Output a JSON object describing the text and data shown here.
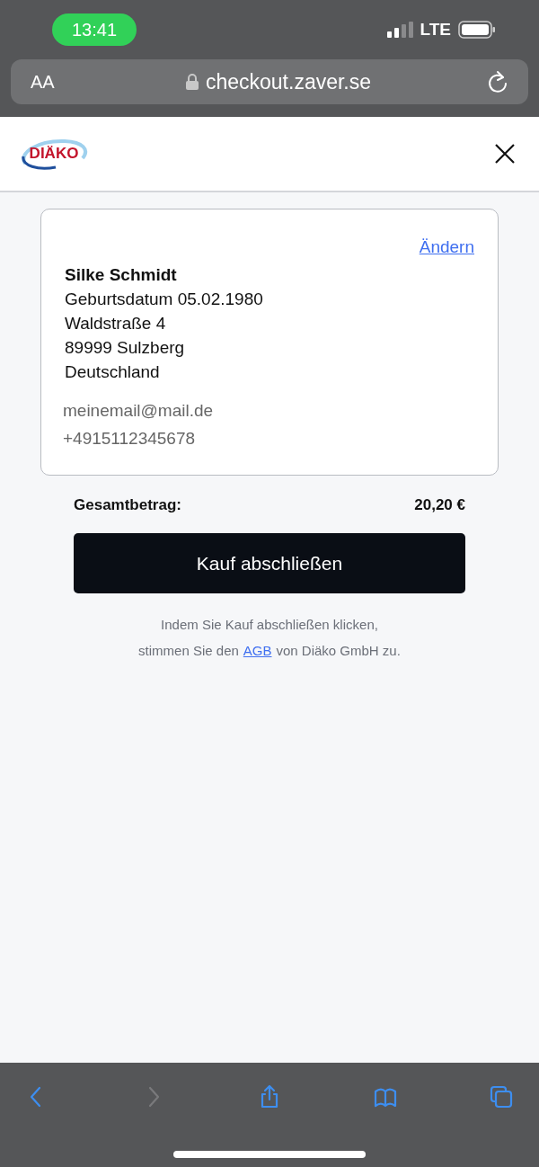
{
  "status_bar": {
    "time": "13:41",
    "network": "LTE"
  },
  "browser": {
    "text_size": "AA",
    "url": "checkout.zaver.se"
  },
  "header": {
    "logo": "DIÄKO"
  },
  "customer": {
    "change_link": "Ändern",
    "name": "Silke Schmidt",
    "lines": [
      "Geburtsdatum 05.02.1980",
      "Waldstraße 4",
      "89999 Sulzberg",
      "Deutschland"
    ],
    "contacts": [
      "meinemail@mail.de",
      "+4915112345678"
    ]
  },
  "total": {
    "label": "Gesamtbetrag:",
    "amount": "20,20 €"
  },
  "submit_button": "Kauf abschließen",
  "terms": {
    "line_1": "Indem Sie Kauf abschließen klicken,",
    "before_link": "stimmen Sie den",
    "link": "AGB",
    "after_link": "von Diäko GmbH zu."
  },
  "toolbar": [
    {
      "kind": "back",
      "disabled": false
    },
    {
      "kind": "forward",
      "disabled": true
    },
    {
      "kind": "share",
      "disabled": false
    },
    {
      "kind": "bookmarks",
      "disabled": false
    },
    {
      "kind": "tabs",
      "disabled": false
    }
  ]
}
